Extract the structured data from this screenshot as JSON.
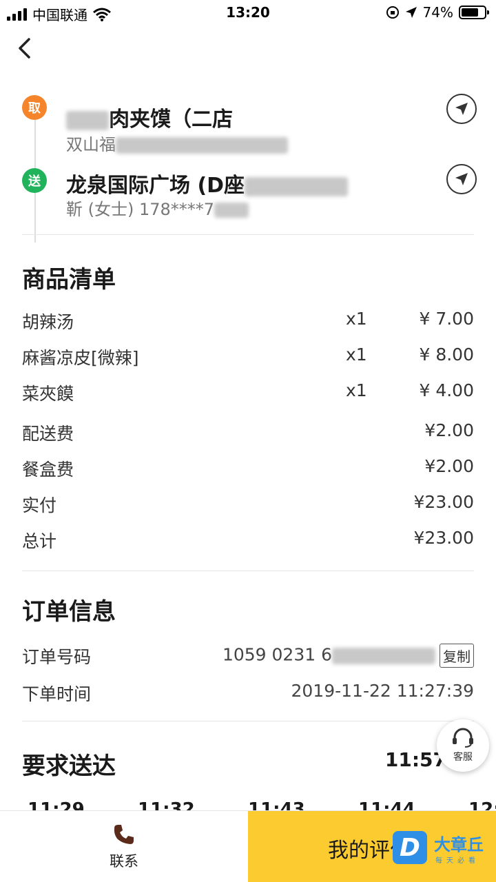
{
  "status_bar": {
    "carrier": "中国联通",
    "time": "13:20",
    "battery": "74%",
    "battery_level": 0.74
  },
  "route": {
    "pickup": {
      "badge": "取",
      "title": "肉夹馍（二店",
      "subtitle": "双山福"
    },
    "delivery": {
      "badge": "送",
      "title": "龙泉国际广场 (D座",
      "subtitle": "靳 (女士)  178****7"
    }
  },
  "goods": {
    "title": "商品清单",
    "items": [
      {
        "name": "胡辣汤",
        "qty": "x1",
        "price": "¥ 7.00"
      },
      {
        "name": "麻酱凉皮[微辣]",
        "qty": "x1",
        "price": "¥ 8.00"
      },
      {
        "name": "菜夾饃",
        "qty": "x1",
        "price": "¥ 4.00"
      }
    ],
    "fees": [
      {
        "label": "配送费",
        "value": "¥2.00"
      },
      {
        "label": "餐盒费",
        "value": "¥2.00"
      },
      {
        "label": "实付",
        "value": "¥23.00"
      },
      {
        "label": "总计",
        "value": "¥23.00"
      }
    ]
  },
  "order_info": {
    "title": "订单信息",
    "order_number_label": "订单号码",
    "order_number": "1059 0231 6",
    "copy_label": "复制",
    "order_time_label": "下单时间",
    "order_time": "2019-11-22 11:27:39"
  },
  "delivery": {
    "title": "要求送达",
    "time": "11:57",
    "timeline": [
      "11:29",
      "11:32",
      "11:43",
      "11:44",
      "12:"
    ]
  },
  "customer_service": {
    "label": "客服"
  },
  "bottom_bar": {
    "contact_label": "联系",
    "review_label": "我的评价"
  },
  "watermark": {
    "logo": "D",
    "text": "大章丘",
    "sub": "每天必看"
  }
}
